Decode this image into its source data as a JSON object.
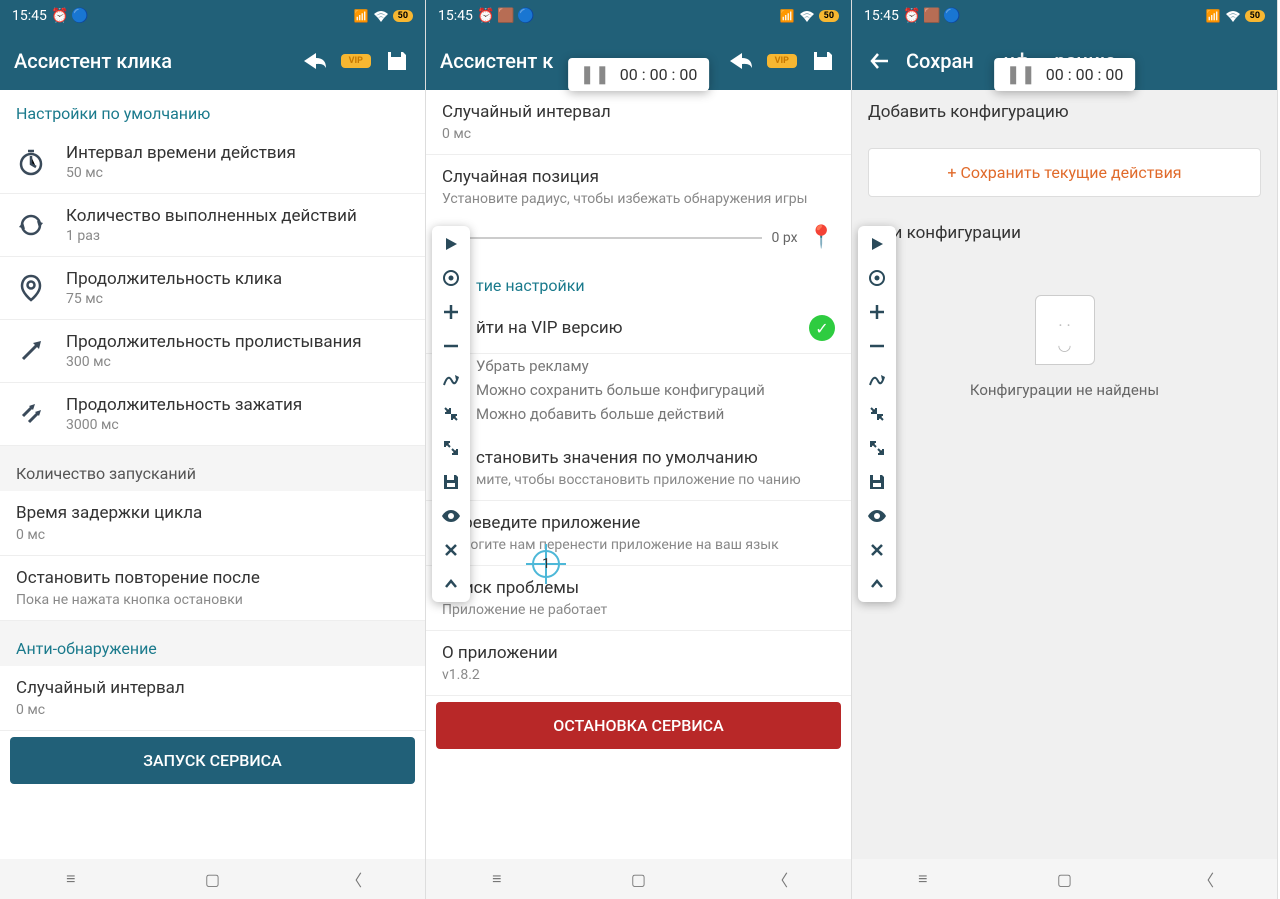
{
  "statusbar": {
    "time": "15:45",
    "battery": "50"
  },
  "screen1": {
    "title": "Ассистент клика",
    "vip_label": "VIP",
    "sec1": "Настройки по умолчанию",
    "items": [
      {
        "title": "Интервал времени действия",
        "sub": "50 мс"
      },
      {
        "title": "Количество выполненных действий",
        "sub": "1 раз"
      },
      {
        "title": "Продолжительность клика",
        "sub": "75 мс"
      },
      {
        "title": "Продолжительность пролистывания",
        "sub": "300 мс"
      },
      {
        "title": "Продолжительность зажатия",
        "sub": "3000 мс"
      }
    ],
    "sec2": "Количество запусканий",
    "r1t": "Время задержки цикла",
    "r1s": "0 мс",
    "r2t": "Остановить повторение после",
    "r2s": "Пока не нажата кнопка остановки",
    "sec3": "Анти-обнаружение",
    "r3t": "Случайный интервал",
    "r3s": "0 мс",
    "btn": "ЗАПУСК СЕРВИСА"
  },
  "screen2": {
    "title": "Ассистент к",
    "timer": "00 : 00 : 00",
    "r1t": "Случайный интервал",
    "r1s": "0 мс",
    "r2t": "Случайная позиция",
    "r2s": "Установите радиус, чтобы избежать обнаружения игры",
    "slider_val": "0 px",
    "sec1": "тие настройки",
    "vip_title": "йти на VIP версию",
    "bullets": [
      "Убрать рекламу",
      "Можно сохранить больше конфигураций",
      "Можно добавить больше действий"
    ],
    "r3t": "становить значения по умолчанию",
    "r3s": "мите, чтобы восстановить приложение по чанию",
    "r4t": "Переведите приложение",
    "r4s": "Помогите нам перенести приложение на ваш язык",
    "r5t": "Поиск проблемы",
    "r5s": "Приложение не работает",
    "r6t": "О приложении",
    "r6s": "v1.8.2",
    "btn": "ОСТАНОВКА СЕРВИСА",
    "crosshair": "1"
  },
  "screen3": {
    "title": "Сохран      нф     рацию",
    "timer": "00 : 00 : 00",
    "sec1": "Добавить конфигурацию",
    "save_btn": "+ Сохранить текущие действия",
    "sec2": "Мои конфигурации",
    "empty": "Конфигурации не найдены"
  }
}
